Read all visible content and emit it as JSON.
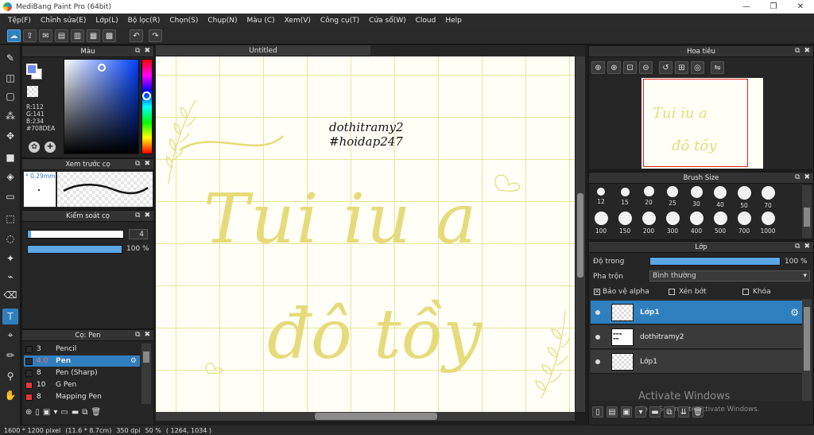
{
  "window": {
    "title": "MediBang Paint Pro (64bit)",
    "minimize": "—",
    "maximize": "❐",
    "close": "✕"
  },
  "menu": [
    "Tệp(F)",
    "Chỉnh sửa(E)",
    "Lớp(L)",
    "Bộ lọc(R)",
    "Chọn(S)",
    "Chụp(N)",
    "Màu (C)",
    "Xem(V)",
    "Công cụ(T)",
    "Cửa sổ(W)",
    "Cloud",
    "Help"
  ],
  "color_panel": {
    "title": "Màu",
    "r": "R:112",
    "g": "G:141",
    "b": "B:234",
    "hex": "#708DEA",
    "primary_color": "#708DEA",
    "secondary_color": "#ffffff"
  },
  "brush_preview_panel": {
    "title": "Xem trước cọ",
    "size": "* 0.29mm"
  },
  "brush_control_panel": {
    "title": "Kiểm soát cọ",
    "size_value": "4",
    "opacity_value": "100 %"
  },
  "brush_list_panel": {
    "title": "Cọ: Pen",
    "items": [
      {
        "size": "3",
        "name": "Pencil",
        "color": "#2a2a2a"
      },
      {
        "size": "4.0",
        "name": "Pen",
        "color": "#2a2a2a",
        "selected": true
      },
      {
        "size": "8",
        "name": "Pen (Sharp)",
        "color": "#2a2a2a"
      },
      {
        "size": "10",
        "name": "G Pen",
        "color": "#e53935"
      },
      {
        "size": "8",
        "name": "Mapping Pen",
        "color": "#e53935"
      }
    ]
  },
  "document": {
    "tab_title": "Untitled"
  },
  "canvas_text": {
    "signature_line1": "dothitramy2",
    "signature_line2": "#hoidap247",
    "line1": "Tui iu a",
    "line2": "đô tồy"
  },
  "navigator_panel": {
    "title": "Hoa tiêu"
  },
  "brush_size_panel": {
    "title": "Brush Size",
    "sizes_row1": [
      "12",
      "15",
      "20",
      "25",
      "30",
      "40",
      "50",
      "70"
    ],
    "sizes_row2": [
      "100",
      "150",
      "200",
      "300",
      "400",
      "500",
      "700",
      "1000"
    ]
  },
  "layer_panel": {
    "title": "Lớp",
    "opacity_label": "Độ trong",
    "opacity_value": "100 %",
    "blend_label": "Pha trộn",
    "blend_value": "Bình thường",
    "protect_alpha": "Bảo vệ alpha",
    "clipping": "Xén bớt",
    "lock": "Khóa",
    "layers": [
      {
        "name": "Lớp1",
        "selected": true
      },
      {
        "name": "dothitramy2",
        "selected": false
      },
      {
        "name": "Lớp1",
        "selected": false
      }
    ]
  },
  "watermark": {
    "line1": "Activate Windows",
    "line2": "Go to Settings to activate Windows."
  },
  "status": {
    "size": "1600 * 1200 pixel",
    "physical": "(11.6 * 8.7cm)",
    "dpi": "350 dpi",
    "zoom": "50 %",
    "coords": "( 1264, 1034 )"
  },
  "colors": {
    "accent": "#2f7fbf",
    "ink": "#e6db7a",
    "grid": "#e8e39a"
  }
}
